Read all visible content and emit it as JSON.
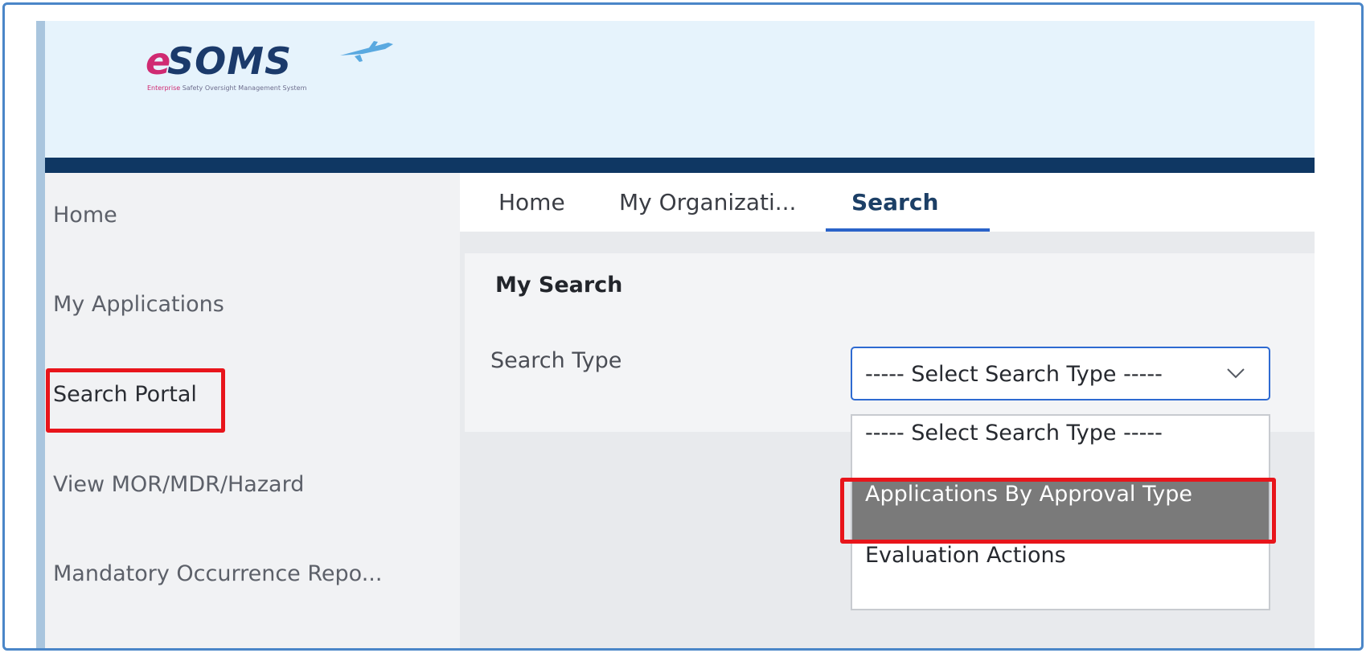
{
  "logo": {
    "letter_e": "e",
    "word": "SOMS",
    "tagline_accent": "Enterprise",
    "tagline_rest": " Safety Oversight Management System"
  },
  "sidebar": {
    "items": [
      {
        "label": "Home"
      },
      {
        "label": "My Applications"
      },
      {
        "label": "Search Portal"
      },
      {
        "label": "View MOR/MDR/Hazard"
      },
      {
        "label": "Mandatory Occurrence Repo..."
      }
    ]
  },
  "tabs": [
    {
      "label": "Home"
    },
    {
      "label": "My Organizati..."
    },
    {
      "label": "Search"
    }
  ],
  "search": {
    "title": "My Search",
    "type_label": "Search Type",
    "selected_value": "----- Select Search Type -----",
    "options": [
      "----- Select Search Type -----",
      "Applications By Approval Type",
      "Evaluation Actions"
    ]
  },
  "colors": {
    "highlight_box": "#e8151b",
    "header_bg": "#e6f3fc",
    "navy_bar": "#0f3763",
    "accent": "#2a63c9",
    "logo_pink": "#d02a72",
    "logo_navy": "#1b3a6b"
  }
}
